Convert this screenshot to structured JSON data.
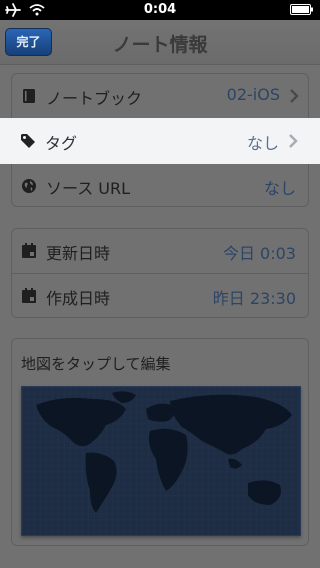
{
  "status_bar": {
    "time": "0:04"
  },
  "nav": {
    "done_label": "完了",
    "title": "ノート情報"
  },
  "group1": {
    "notebook": {
      "label": "ノートブック",
      "value": "02-iOS",
      "icon": "notebook-icon"
    },
    "tag": {
      "label": "タグ",
      "value": "なし",
      "icon": "tag-icon"
    },
    "source_url": {
      "label": "ソース URL",
      "value": "なし",
      "icon": "globe-icon"
    }
  },
  "group2": {
    "updated": {
      "label": "更新日時",
      "value": "今日 0:03",
      "icon": "calendar-icon"
    },
    "created": {
      "label": "作成日時",
      "value": "昨日 23:30",
      "icon": "calendar-icon"
    }
  },
  "map": {
    "label": "地図をタップして編集"
  },
  "colors": {
    "accent": "#1f4f95",
    "highlight": "#f3f4f6",
    "overlay": "#717171"
  }
}
